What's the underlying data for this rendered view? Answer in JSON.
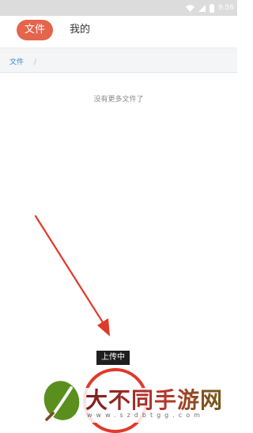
{
  "status_bar": {
    "time": "9:56",
    "icons": [
      "wifi-icon",
      "signal-icon",
      "battery-icon"
    ]
  },
  "header": {
    "tabs": [
      {
        "label": "文件",
        "active": true
      },
      {
        "label": "我的",
        "active": false
      }
    ]
  },
  "breadcrumb": {
    "root": "文件",
    "separator": "/"
  },
  "file_list": {
    "empty_message": "没有更多文件了"
  },
  "upload": {
    "tooltip": "上传中"
  },
  "watermark": {
    "title": "大不同手游网",
    "url": "www.szdbtgg.com"
  },
  "colors": {
    "accent": "#e4644c",
    "link": "#3d86c6",
    "annotation_arrow": "#e03a2a",
    "fab_ring": "#e03a2a"
  }
}
